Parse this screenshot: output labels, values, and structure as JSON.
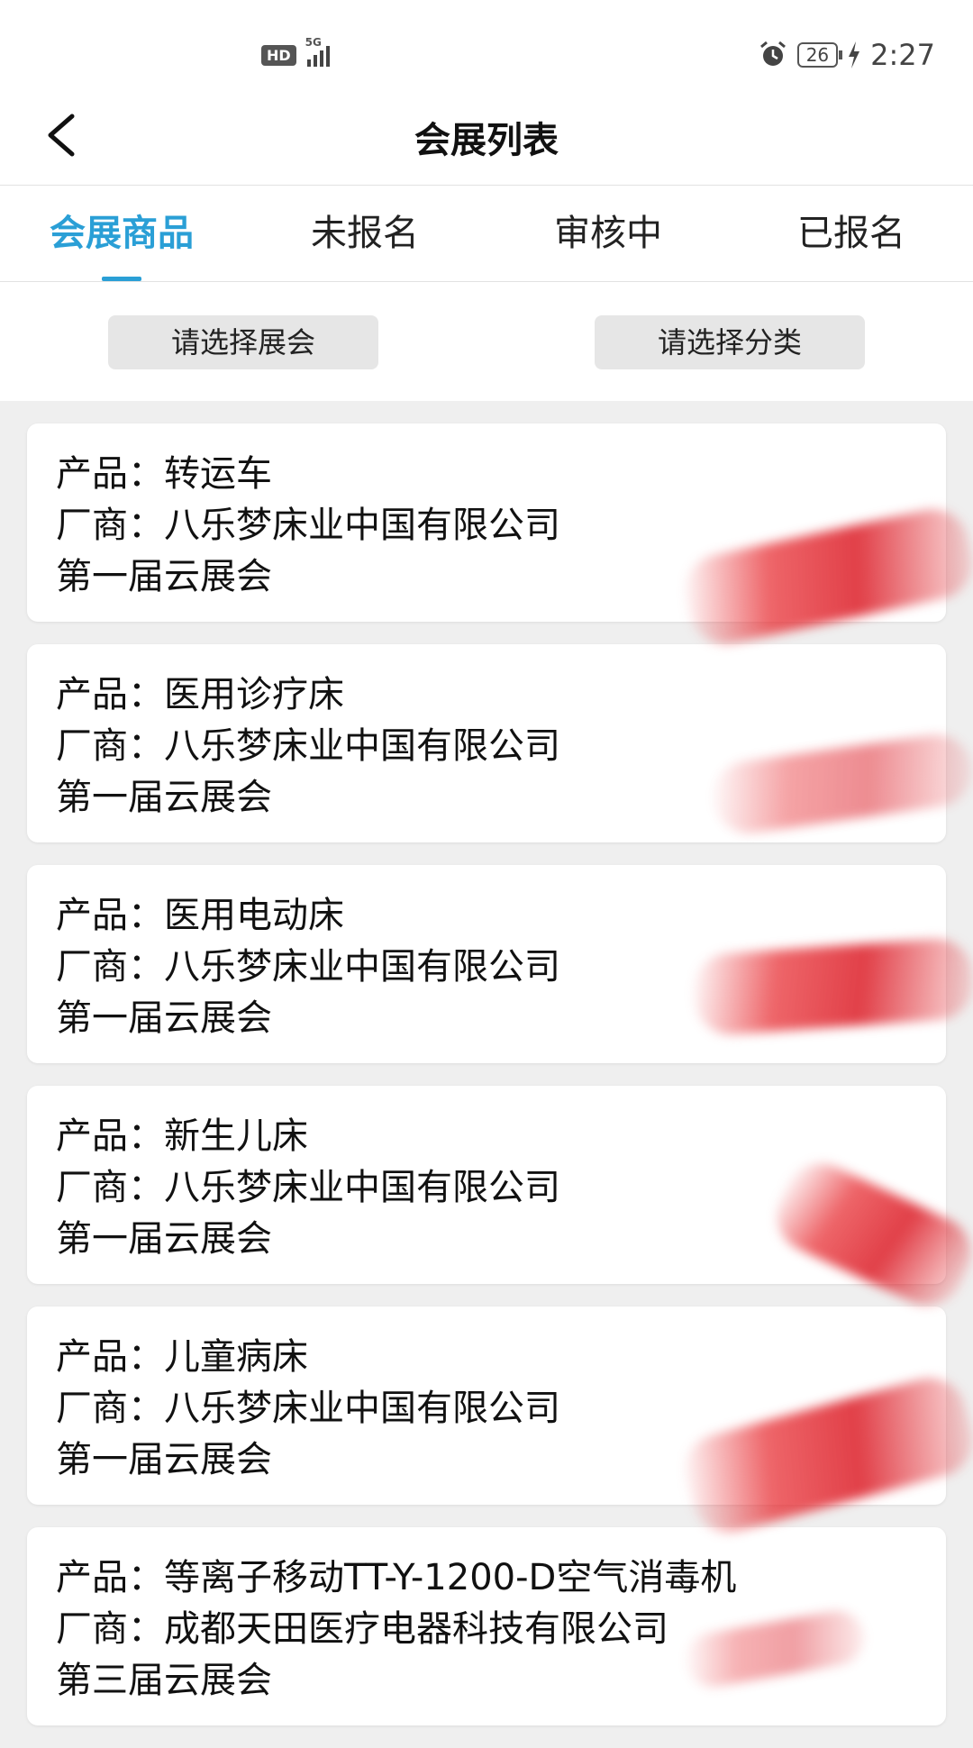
{
  "status_bar": {
    "hd": "HD",
    "network": "5G",
    "battery": "26",
    "time": "2:27"
  },
  "header": {
    "title": "会展列表"
  },
  "tabs": [
    {
      "label": "会展商品",
      "active": true
    },
    {
      "label": "未报名",
      "active": false
    },
    {
      "label": "审核中",
      "active": false
    },
    {
      "label": "已报名",
      "active": false
    }
  ],
  "filters": {
    "exhibition": "请选择展会",
    "category": "请选择分类"
  },
  "labels": {
    "product": "产品：",
    "manufacturer": "厂商："
  },
  "items": [
    {
      "product": "转运车",
      "manufacturer": "八乐梦床业中国有限公司",
      "expo": "第一届云展会"
    },
    {
      "product": "医用诊疗床",
      "manufacturer": "八乐梦床业中国有限公司",
      "expo": "第一届云展会"
    },
    {
      "product": "医用电动床",
      "manufacturer": "八乐梦床业中国有限公司",
      "expo": "第一届云展会"
    },
    {
      "product": "新生儿床",
      "manufacturer": "八乐梦床业中国有限公司",
      "expo": "第一届云展会"
    },
    {
      "product": "儿童病床",
      "manufacturer": "八乐梦床业中国有限公司",
      "expo": "第一届云展会"
    },
    {
      "product": "等离子移动TT-Y-1200-D空气消毒机",
      "manufacturer": "成都天田医疗电器科技有限公司",
      "expo": "第三届云展会"
    }
  ],
  "colors": {
    "accent": "#2a9fd6",
    "brush": "#e8323a"
  }
}
